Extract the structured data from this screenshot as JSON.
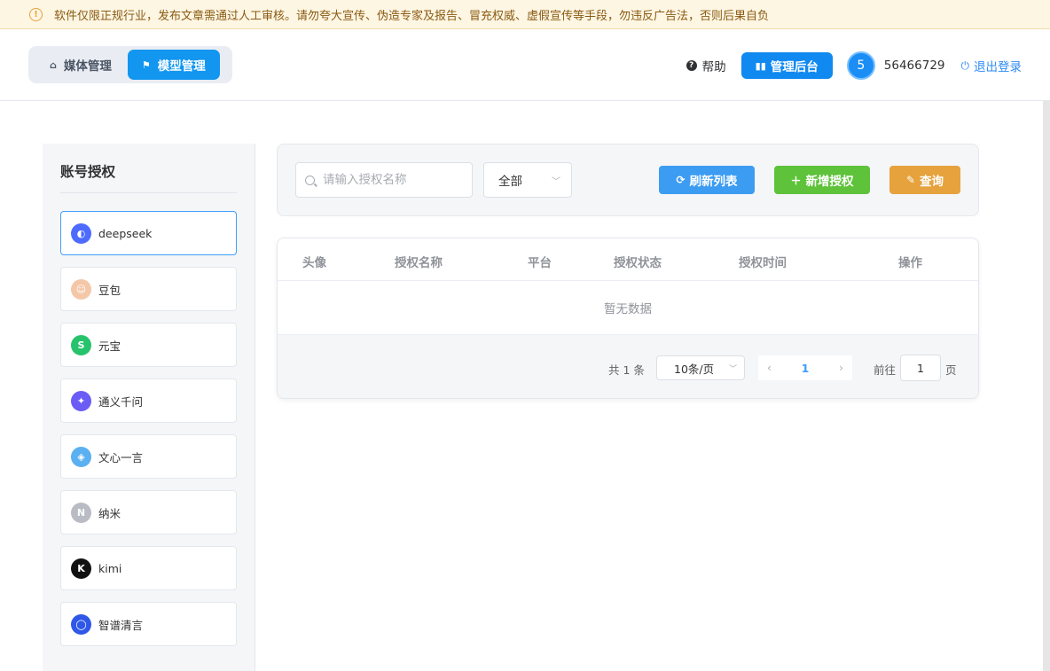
{
  "notice": {
    "text": "软件仅限正规行业，发布文章需通过人工审核。请勿夸大宣传、伪造专家及报告、冒充权威、虚假宣传等手段，勿违反广告法，否则后果自负",
    "icon": "warning-icon"
  },
  "header": {
    "tabs": [
      {
        "label": "媒体管理",
        "icon": "home-icon",
        "active": false
      },
      {
        "label": "模型管理",
        "icon": "flag-icon",
        "active": true
      }
    ],
    "help_label": "帮助",
    "admin_label": "管理后台",
    "avatar_text": "5",
    "user_id": "56466729",
    "logout_label": "退出登录"
  },
  "sidebar": {
    "title": "账号授权",
    "accounts": [
      {
        "name": "deepseek",
        "icon": "deepseek-logo-icon",
        "color": "#4d6bfe",
        "selected": true
      },
      {
        "name": "豆包",
        "icon": "doubao-logo-icon",
        "color": "#f4c7a8",
        "selected": false
      },
      {
        "name": "元宝",
        "icon": "yuanbao-logo-icon",
        "color": "#27c26c",
        "selected": false
      },
      {
        "name": "通义千问",
        "icon": "tongyi-logo-icon",
        "color": "#6b5cf5",
        "selected": false
      },
      {
        "name": "文心一言",
        "icon": "wenxin-logo-icon",
        "color": "#5ab0f0",
        "selected": false
      },
      {
        "name": "纳米",
        "icon": "nami-logo-icon",
        "color": "#b9bcc4",
        "selected": false
      },
      {
        "name": "kimi",
        "icon": "kimi-logo-icon",
        "color": "#111111",
        "selected": false
      },
      {
        "name": "智谱清言",
        "icon": "zhipu-logo-icon",
        "color": "#2f57e8",
        "selected": false
      }
    ]
  },
  "toolbar": {
    "search_placeholder": "请输入授权名称",
    "filter_value": "全部",
    "refresh_label": "刷新列表",
    "add_label": "新增授权",
    "query_label": "查询"
  },
  "table": {
    "columns": [
      "头像",
      "授权名称",
      "平台",
      "授权状态",
      "授权时间",
      "操作"
    ],
    "empty_text": "暂无数据"
  },
  "pagination": {
    "total_text": "共 1 条",
    "page_size": "10条/页",
    "current_page": "1",
    "goto_label": "前往",
    "goto_value": "1",
    "page_unit": "页"
  }
}
